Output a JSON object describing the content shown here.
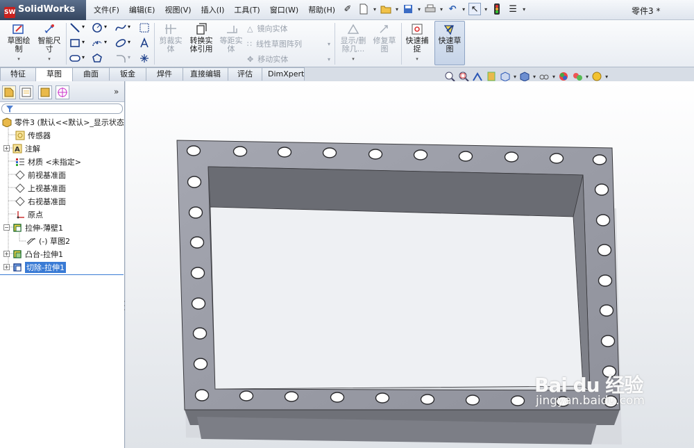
{
  "app": {
    "name": "SolidWorks",
    "doc_title": "零件3 *"
  },
  "menu": [
    "文件(F)",
    "编辑(E)",
    "视图(V)",
    "插入(I)",
    "工具(T)",
    "窗口(W)",
    "帮助(H)"
  ],
  "ribbon": {
    "sketch": "草图绘\n制",
    "smart_dim": "智能尺\n寸",
    "trim": "剪裁实\n体",
    "convert": "转换实\n体引用",
    "offset": "等距实\n体",
    "mirror": "镜向实体",
    "linear_pattern": "线性草图阵列",
    "move": "移动实体",
    "show_delete": "显示/删\n除几...",
    "repair": "修复草\n图",
    "quick_snap": "快速捕\n捉",
    "rapid_sketch": "快速草\n图"
  },
  "tabs": [
    "特征",
    "草图",
    "曲面",
    "钣金",
    "焊件",
    "直接编辑",
    "评估",
    "DimXpert"
  ],
  "selected_tab": "草图",
  "tree": {
    "root": "零件3 (默认<<默认>_显示状态",
    "items": [
      {
        "label": "传感器"
      },
      {
        "label": "注解"
      },
      {
        "label": "材质 <未指定>"
      },
      {
        "label": "前视基准面"
      },
      {
        "label": "上视基准面"
      },
      {
        "label": "右视基准面"
      },
      {
        "label": "原点"
      },
      {
        "label": "拉伸-薄壁1"
      },
      {
        "label": "(-) 草图2"
      },
      {
        "label": "凸台-拉伸1"
      },
      {
        "label": "切除-拉伸1"
      }
    ]
  },
  "watermark": {
    "line1": "Bai du 经验",
    "line2": "jingyan.baidu.com"
  },
  "colors": {
    "accent": "#3a7bd5",
    "part_face": "#9c9ea8",
    "part_inner": "#6a6c73"
  }
}
